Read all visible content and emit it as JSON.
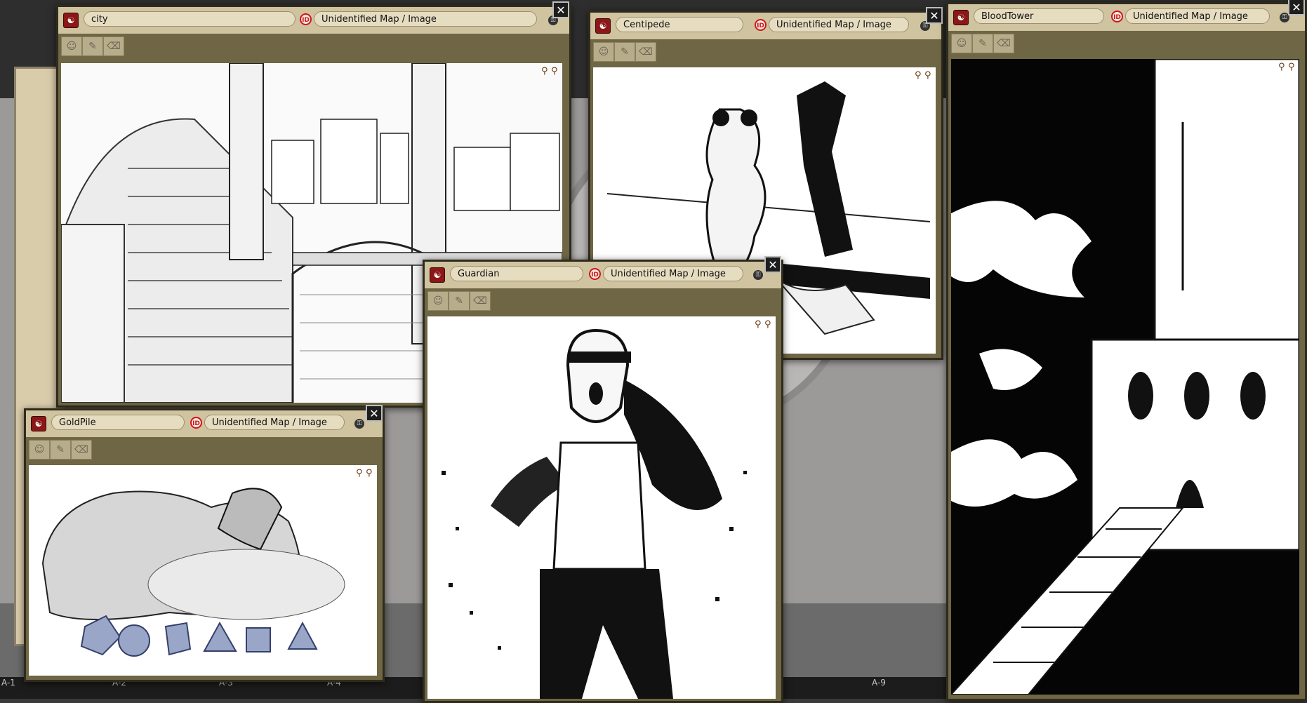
{
  "windows": {
    "city": {
      "name": "city",
      "type": "Unidentified Map / Image"
    },
    "centipede": {
      "name": "Centipede",
      "type": "Unidentified Map / Image"
    },
    "bloodtower": {
      "name": "BloodTower",
      "type": "Unidentified Map / Image"
    },
    "guardian": {
      "name": "Guardian",
      "type": "Unidentified Map / Image"
    },
    "goldpile": {
      "name": "GoldPile",
      "type": "Unidentified Map / Image"
    }
  },
  "icons": {
    "app": "fantasy-grounds-icon",
    "identified": "id-badge-icon",
    "lock": "lock-icon",
    "close": "close-icon",
    "tools": [
      "mask-icon",
      "pencil-icon",
      "eraser-icon"
    ],
    "pins": [
      "pin-icon",
      "pointer-icon"
    ]
  },
  "desktop": {
    "labels": [
      "A-1",
      "A-2",
      "A-3",
      "A-4",
      "A-9"
    ]
  },
  "colors": {
    "titlebar": "#cfc3a0",
    "window_frame": "#6e6644",
    "id_badge": "#d0151b"
  }
}
